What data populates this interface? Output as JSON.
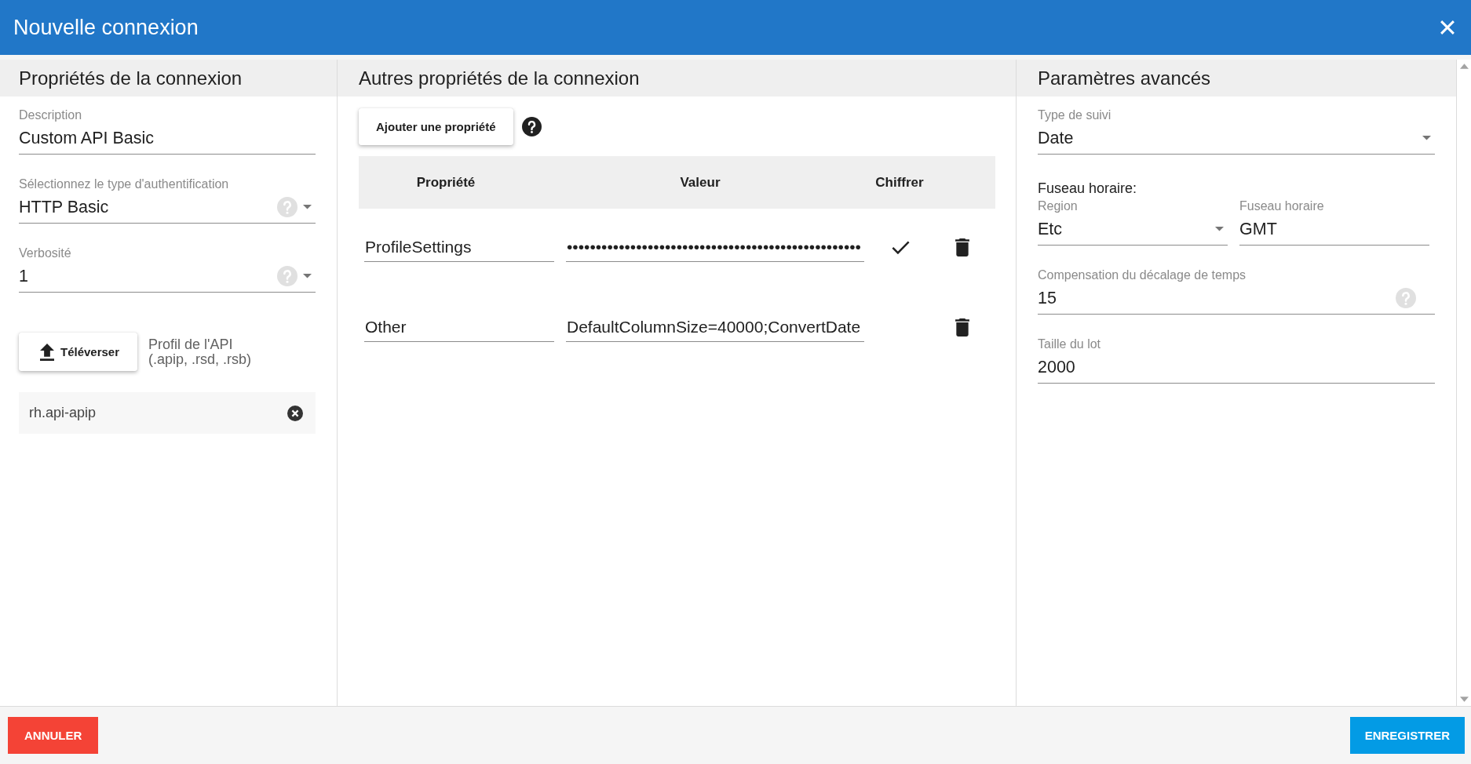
{
  "window": {
    "title": "Nouvelle connexion"
  },
  "connection": {
    "heading": "Propriétés de la connexion",
    "fields": [
      {
        "kind": "text",
        "label": "Description",
        "value": "Custom API Basic"
      },
      {
        "kind": "select",
        "label": "Sélectionnez le type d'authentification",
        "value": "HTTP Basic",
        "help": true
      },
      {
        "kind": "select",
        "label": "Verbosité",
        "value": "1",
        "help": true
      }
    ],
    "upload": {
      "button": "Téléverser",
      "caption": "Profil de l'API\n(.apip, .rsd, .rsb)"
    },
    "file": {
      "name": "rh.api-apip"
    }
  },
  "other": {
    "heading": "Autres propriétés de la connexion",
    "add_button": "Ajouter une propriété",
    "table": {
      "columns": [
        "Propriété",
        "Valeur",
        "Chiffrer"
      ],
      "rows": [
        {
          "property": "ProfileSettings",
          "value": "•••••••••••••••••••••••••••••••••••••••••••••••••••",
          "encrypted": true
        },
        {
          "property": "Other",
          "value": "DefaultColumnSize=40000;ConvertDate",
          "encrypted": false
        }
      ]
    }
  },
  "advanced": {
    "heading": "Paramètres avancés",
    "fields": [
      {
        "kind": "select",
        "label": "Type de suivi",
        "value": "Date"
      },
      {
        "kind": "group",
        "title": "Fuseau horaire:",
        "fields": [
          {
            "kind": "select",
            "label": "Region",
            "value": "Etc"
          },
          {
            "kind": "text",
            "label": "Fuseau horaire",
            "value": "GMT"
          }
        ]
      },
      {
        "kind": "text",
        "label": "Compensation du décalage de temps",
        "value": "15",
        "help": true
      },
      {
        "kind": "text",
        "label": "Taille du lot",
        "value": "2000"
      }
    ]
  },
  "footer": {
    "buttons": [
      {
        "kind": "cancel",
        "label": "ANNULER"
      },
      {
        "kind": "save",
        "label": "ENREGISTRER"
      }
    ]
  }
}
